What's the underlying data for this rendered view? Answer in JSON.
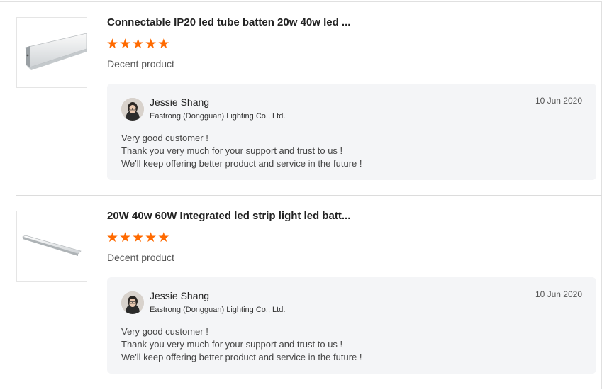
{
  "reviews": [
    {
      "product_title": "Connectable IP20 led tube batten 20w 40w led ...",
      "rating": 5,
      "rating_text": "Decent product",
      "reply": {
        "name": "Jessie Shang",
        "company": "Eastrong (Dongguan) Lighting Co., Ltd.",
        "date": "10 Jun 2020",
        "lines": [
          "Very good customer !",
          "Thank you very much for your support and trust to us !",
          "We'll keep offering better product and service in the future !"
        ]
      }
    },
    {
      "product_title": "20W 40w 60W Integrated led strip light led batt...",
      "rating": 5,
      "rating_text": "Decent product",
      "reply": {
        "name": "Jessie Shang",
        "company": "Eastrong (Dongguan) Lighting Co., Ltd.",
        "date": "10 Jun 2020",
        "lines": [
          "Very good customer !",
          "Thank you very much for your support and trust to us !",
          "We'll keep offering better product and service in the future !"
        ]
      }
    }
  ],
  "colors": {
    "star": "#ff6a00",
    "reply_bg": "#f4f5f7"
  },
  "icons": {
    "star": "star-icon"
  }
}
